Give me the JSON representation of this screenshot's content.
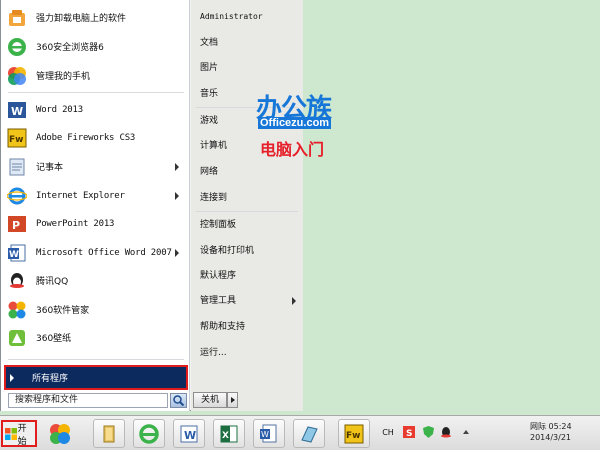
{
  "start_menu": {
    "recent_programs": [
      {
        "label": "强力卸载电脑上的软件",
        "icon": "uninstall-icon"
      },
      {
        "label": "360安全浏览器6",
        "icon": "360-browser-icon"
      },
      {
        "label": "管理我的手机",
        "icon": "phone-manager-icon"
      },
      {
        "label": "Word 2013",
        "icon": "word-icon"
      },
      {
        "label": "Adobe Fireworks CS3",
        "icon": "fireworks-icon"
      },
      {
        "label": "记事本",
        "icon": "notepad-icon"
      },
      {
        "label": "Internet Explorer",
        "icon": "ie-icon"
      },
      {
        "label": "PowerPoint 2013",
        "icon": "powerpoint-icon"
      },
      {
        "label": "Microsoft Office Word 2007",
        "icon": "word2007-icon"
      },
      {
        "label": "腾讯QQ",
        "icon": "qq-icon"
      },
      {
        "label": "360软件管家",
        "icon": "360-software-icon"
      },
      {
        "label": "360壁纸",
        "icon": "360-wallpaper-icon"
      }
    ],
    "all_programs_label": "所有程序",
    "search_placeholder": "搜索程序和文件",
    "right_items": [
      {
        "label": "Administrator"
      },
      {
        "label": "文档"
      },
      {
        "label": "图片"
      },
      {
        "label": "音乐"
      },
      {
        "label": "游戏"
      },
      {
        "label": "计算机"
      },
      {
        "label": "网络"
      },
      {
        "label": "连接到"
      },
      {
        "label": "控制面板"
      },
      {
        "label": "设备和打印机"
      },
      {
        "label": "默认程序"
      },
      {
        "label": "管理工具"
      },
      {
        "label": "帮助和支持"
      },
      {
        "label": "运行..."
      }
    ],
    "shutdown_label": "关机"
  },
  "watermark": {
    "brand": "办公族",
    "url": "Officezu.com",
    "subtitle": "电脑入门"
  },
  "taskbar": {
    "start_label": "开始",
    "pinned": [
      "360-icon",
      "folder-icon",
      "ie-icon",
      "word-doc-icon",
      "excel-icon",
      "document-icon",
      "notepad-icon",
      "fireworks-icon"
    ],
    "tray": {
      "lang": "CH",
      "clock_time": "网际  05:24",
      "clock_date": "2014/3/21"
    }
  },
  "colors": {
    "desktop": "#cde8cf",
    "all_programs_bg": "#0d2a5e",
    "highlight_border": "#e01c1c"
  }
}
